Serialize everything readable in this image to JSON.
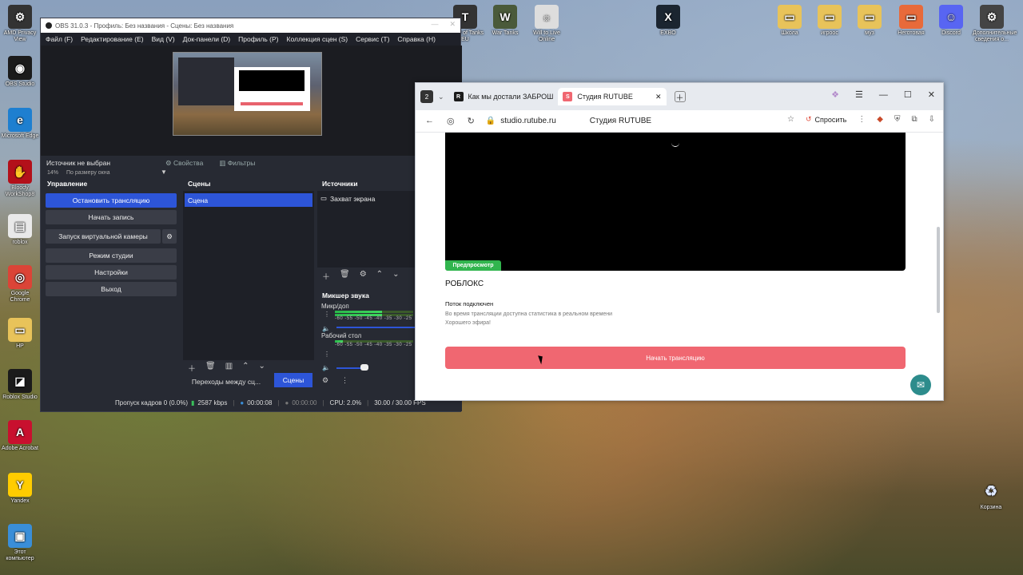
{
  "desktop": {
    "icons_left": [
      {
        "label": "AMD Privacy View",
        "icon": "amd-privacy-icon",
        "color": "#333333",
        "glyph": "⚙"
      },
      {
        "label": "OBS Studio",
        "icon": "obs-icon",
        "color": "#1b1b1b",
        "glyph": "◉"
      },
      {
        "label": "Microsoft Edge",
        "icon": "edge-icon",
        "color": "#1e7fd0",
        "glyph": "e"
      },
      {
        "label": "Bloody WorkShop8",
        "icon": "bloody-icon",
        "color": "#b3101a",
        "glyph": "✋"
      },
      {
        "label": "roblox",
        "icon": "file-icon",
        "color": "#e9e9e9",
        "glyph": "▤"
      },
      {
        "label": "Google Chrome",
        "icon": "chrome-icon",
        "color": "#db4437",
        "glyph": "◎"
      },
      {
        "label": "HP",
        "icon": "folder-icon",
        "color": "#e8c35a",
        "glyph": "▭"
      },
      {
        "label": "Roblox Studio",
        "icon": "roblox-studio-icon",
        "color": "#1b1b1b",
        "glyph": "◪"
      },
      {
        "label": "Adobe Acrobat",
        "icon": "acrobat-icon",
        "color": "#c8102e",
        "glyph": "A"
      },
      {
        "label": "Yandex",
        "icon": "yandex-icon",
        "color": "#ffcc00",
        "glyph": "Y"
      },
      {
        "label": "Этот компьютер",
        "icon": "computer-icon",
        "color": "#3a8ed8",
        "glyph": "▣"
      }
    ],
    "icons_top": [
      {
        "label": "World of Tanks EU",
        "icon": "wot-icon",
        "color": "#333333",
        "glyph": "T"
      },
      {
        "label": "War Tanks",
        "icon": "war-tanks-icon",
        "color": "#4a5a3a",
        "glyph": "W"
      },
      {
        "label": "Will to Live Online",
        "icon": "wtl-icon",
        "color": "#dddddd",
        "glyph": "☼"
      },
      {
        "label": "EXBO",
        "icon": "exbo-icon",
        "color": "#1b2530",
        "glyph": "X"
      }
    ],
    "icons_right": [
      {
        "label": "Школа",
        "icon": "folder-school-icon",
        "color": "#e8c35a",
        "glyph": "▭"
      },
      {
        "label": "игроос",
        "icon": "folder-games-icon",
        "color": "#e8c35a",
        "glyph": "▭"
      },
      {
        "label": "муз",
        "icon": "folder-music-icon",
        "color": "#e8c35a",
        "glyph": "▭"
      },
      {
        "label": "Неготовая",
        "icon": "folder-unfinished-icon",
        "color": "#e86a3a",
        "glyph": "▭"
      },
      {
        "label": "Discord",
        "icon": "discord-icon",
        "color": "#5865f2",
        "glyph": "☺"
      },
      {
        "label": "Дополнительные сведения о...",
        "icon": "info-icon",
        "color": "#444444",
        "glyph": "⚙"
      }
    ],
    "recycle_bin": "Корзина"
  },
  "obs": {
    "title": "OBS 31.0.3 - Профиль: Без названия - Сцены: Без названия",
    "menu": [
      "Файл (F)",
      "Редактирование (E)",
      "Вид (V)",
      "Док-панели (D)",
      "Профиль (P)",
      "Коллекция сцен (S)",
      "Сервис (T)",
      "Справка (H)"
    ],
    "zoom": "14%",
    "zoom_mode": "По размеру окна",
    "source_none": "Источник не выбран",
    "properties": "Свойства",
    "filters": "Фильтры",
    "controls": {
      "header": "Управление",
      "stop_stream": "Остановить трансляцию",
      "start_record": "Начать запись",
      "virtual_cam": "Запуск виртуальной камеры",
      "studio_mode": "Режим студии",
      "settings": "Настройки",
      "exit": "Выход"
    },
    "scenes": {
      "header": "Сцены",
      "items": [
        "Сцена"
      ]
    },
    "sources": {
      "header": "Источники",
      "items": [
        "Захват экрана"
      ]
    },
    "mixer": {
      "header": "Микшер звука",
      "tracks": [
        {
          "name": "Микр/доп",
          "level": 0.6
        },
        {
          "name": "Рабочий стол",
          "level": 0.1
        }
      ],
      "scale": "-60 -55 -50 -45 -40 -35 -30 -25"
    },
    "bottom_tabs": {
      "transitions": "Переходы между сц...",
      "scenes": "Сцены"
    },
    "status": {
      "dropped": "Пропуск кадров 0 (0.0%)",
      "bitrate": "2587 kbps",
      "stream_time": "00:00:08",
      "rec_time": "00:00:00",
      "cpu": "CPU: 2.0%",
      "fps": "30.00 / 30.00 FPS"
    }
  },
  "browser": {
    "tab_count": "2",
    "tabs": [
      {
        "title": "Как мы достали ЗАБРОШ",
        "favicon": "R"
      },
      {
        "title": "Студия RUTUBE",
        "favicon": "S"
      }
    ],
    "url": "studio.rutube.ru",
    "page_title": "Студия RUTUBE",
    "ask_label": "Спросить",
    "content": {
      "preview_badge": "Предпросмотр",
      "stream_name": "РОБЛОКС",
      "connected": "Поток подключен",
      "info1": "Во время трансляции доступна статистика в реальном времени",
      "info2": "Хорошего эфира!",
      "start_button": "Начать трансляцию"
    }
  },
  "colors": {
    "obs_accent": "#2d55d8",
    "rutube_red": "#f06771",
    "preview_green": "#31b54e"
  }
}
